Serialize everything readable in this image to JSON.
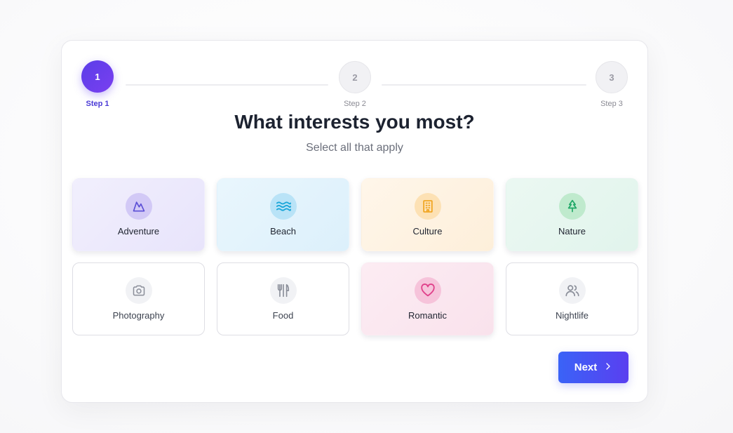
{
  "stepper": {
    "steps": [
      {
        "number": "1",
        "label": "Step 1",
        "state": "active"
      },
      {
        "number": "2",
        "label": "Step 2",
        "state": "inactive"
      },
      {
        "number": "3",
        "label": "Step 3",
        "state": "inactive"
      }
    ]
  },
  "heading": {
    "title": "What interests you most?",
    "subtitle": "Select all that apply"
  },
  "interests": [
    {
      "label": "Adventure",
      "icon": "mountain-icon",
      "selected": true,
      "color": "#5b4fd6"
    },
    {
      "label": "Beach",
      "icon": "waves-icon",
      "selected": true,
      "color": "#1aa6d9"
    },
    {
      "label": "Culture",
      "icon": "building-icon",
      "selected": true,
      "color": "#f0a21a"
    },
    {
      "label": "Nature",
      "icon": "tree-icon",
      "selected": true,
      "color": "#1fa866"
    },
    {
      "label": "Photography",
      "icon": "camera-icon",
      "selected": false,
      "color": "#8a8e99"
    },
    {
      "label": "Food",
      "icon": "utensils-icon",
      "selected": false,
      "color": "#8a8e99"
    },
    {
      "label": "Romantic",
      "icon": "heart-icon",
      "selected": true,
      "color": "#e0408a"
    },
    {
      "label": "Nightlife",
      "icon": "users-icon",
      "selected": false,
      "color": "#8a8e99"
    }
  ],
  "actions": {
    "next_label": "Next",
    "next_icon": "chevron-right-icon"
  },
  "colors": {
    "accent": "#5b3ee8",
    "button_gradient_start": "#3a63f7",
    "button_gradient_end": "#5a3ff0"
  }
}
